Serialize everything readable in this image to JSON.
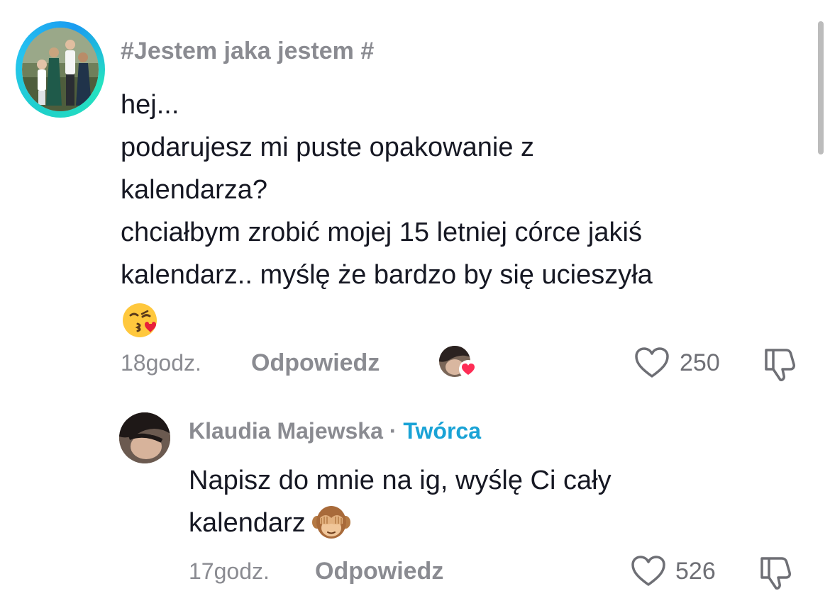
{
  "comment": {
    "username": "#Jestem jaka jestem #",
    "lines": [
      "hej...",
      "podarujesz mi puste opakowanie z",
      "kalendarza?",
      "chciałbym zrobić mojej 15 letniej córce jakiś",
      "kalendarz.. myślę że bardzo by się ucieszyła"
    ],
    "emoji": "kissing-face-with-heart-emoji",
    "time": "18godz.",
    "reply_label": "Odpowiedz",
    "likes": "250"
  },
  "reply": {
    "username": "Klaudia Majewska",
    "separator": "·",
    "badge": "Twórca",
    "lines": [
      "Napisz do mnie na ig, wyślę Ci cały",
      "kalendarz"
    ],
    "emoji": "see-no-evil-monkey-emoji",
    "time": "17godz.",
    "reply_label": "Odpowiedz",
    "likes": "526"
  },
  "colors": {
    "muted_text": "#8a8b91",
    "creator_badge": "#1aa3d6",
    "heart_badge": "#fe2c55",
    "ring_start": "#1fd1c8",
    "ring_end": "#1a9bf0"
  }
}
